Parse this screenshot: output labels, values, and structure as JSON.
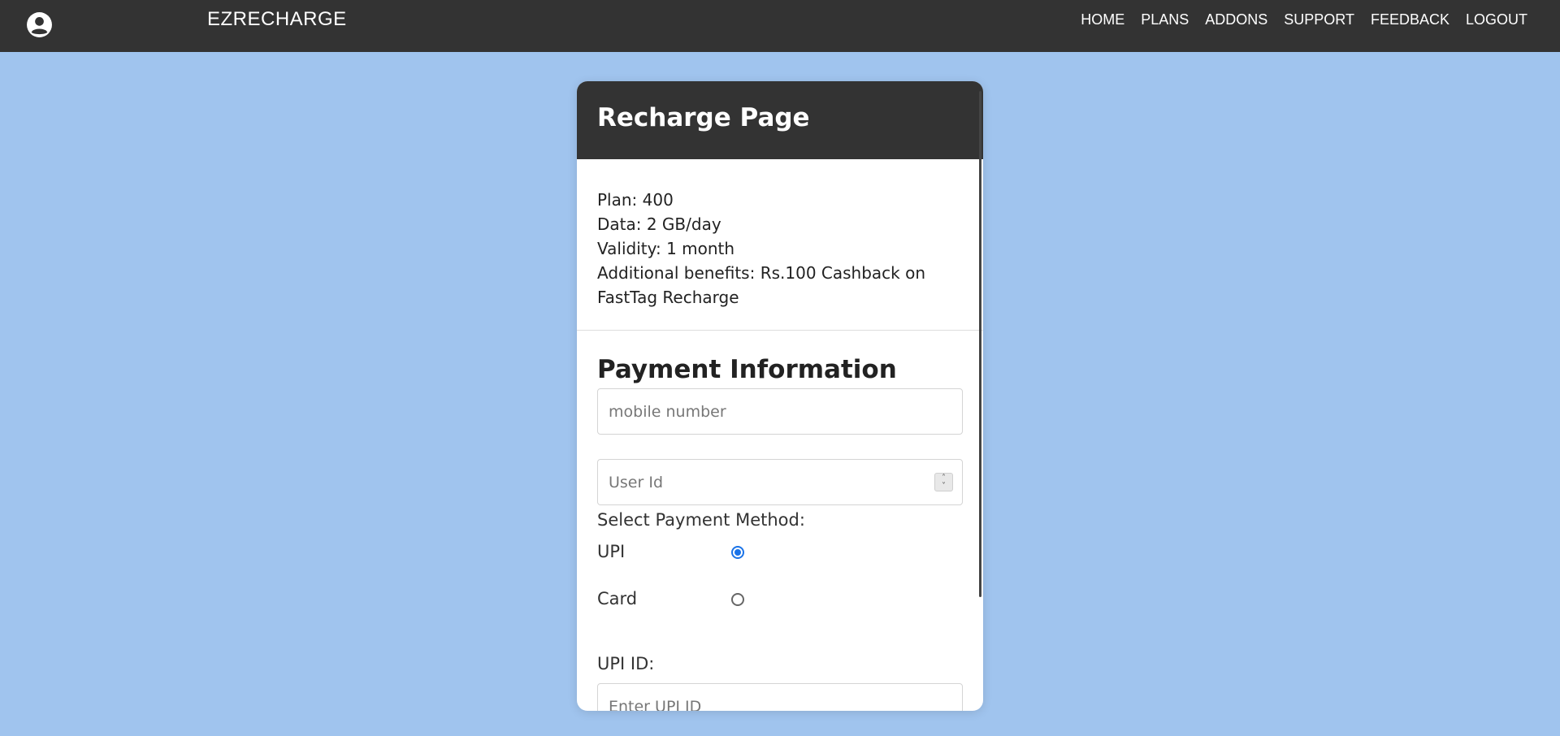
{
  "navbar": {
    "brand": "EZRECHARGE",
    "links": [
      "HOME",
      "PLANS",
      "ADDONS",
      "SUPPORT",
      "FEEDBACK",
      "LOGOUT"
    ]
  },
  "card": {
    "title": "Recharge Page",
    "plan": {
      "lines": [
        "Plan: 400",
        "Data: 2 GB/day",
        "Validity: 1 month",
        "Additional benefits: Rs.100 Cashback on FastTag Recharge"
      ]
    },
    "payment": {
      "title": "Payment Information",
      "mobile_placeholder": "mobile number",
      "userid_placeholder": "User Id",
      "method_label": "Select Payment Method:",
      "methods": [
        {
          "label": "UPI",
          "selected": true
        },
        {
          "label": "Card",
          "selected": false
        }
      ],
      "upi_id_label": "UPI ID:",
      "upi_id_placeholder": "Enter UPI ID"
    }
  },
  "colors": {
    "background": "#a0c4ee",
    "navbar": "#333333",
    "radio_accent": "#1a73e8"
  },
  "icons": {
    "avatar": "user-circle-icon",
    "spinner": "number-spinner-icon"
  }
}
